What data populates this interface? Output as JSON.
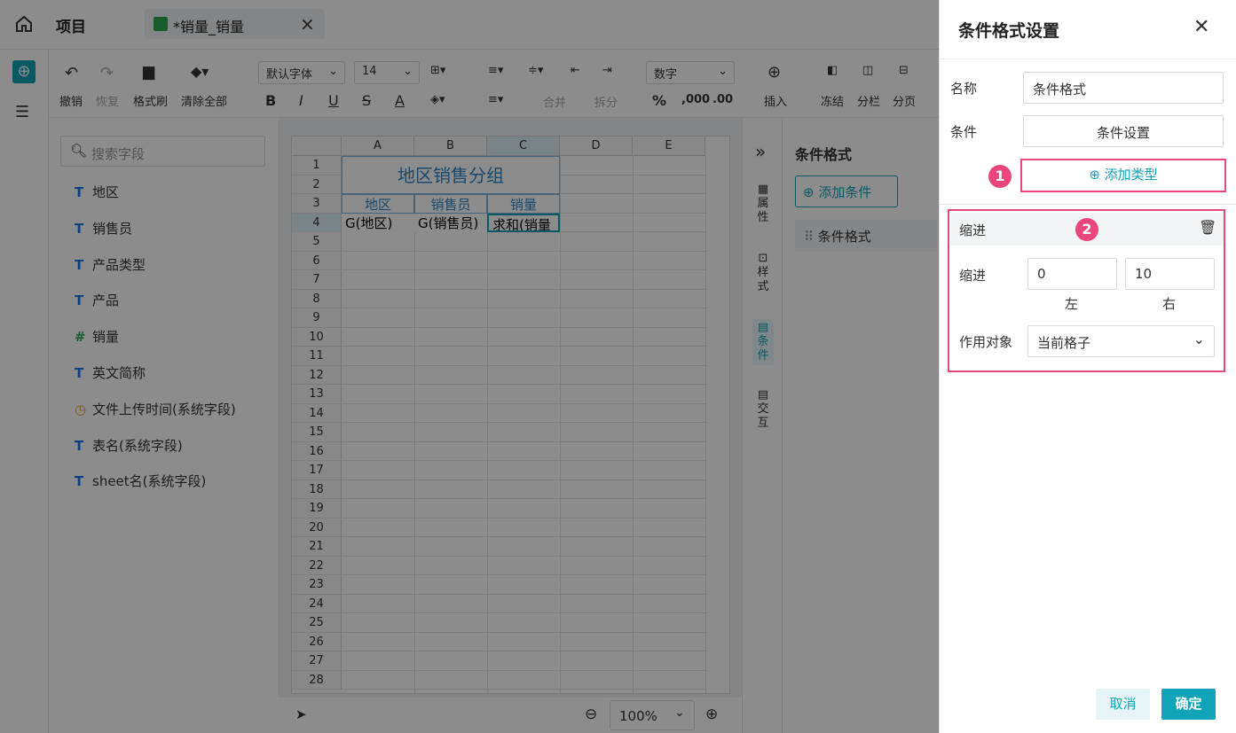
{
  "topbar": {
    "project_label": "项目",
    "tab_title": "*销量_销量",
    "tab_close": "×"
  },
  "ribbon": {
    "undo": "撤销",
    "redo": "恢复",
    "format_painter": "格式刷",
    "clear_all": "清除全部",
    "font_family": "默认字体",
    "font_size": "14",
    "number_format": "数字",
    "merge": "合并",
    "split": "拆分",
    "percent": "%",
    "thousands": ",000",
    "decimals": ".00",
    "insert": "插入",
    "freeze": "冻结",
    "columns": "分栏",
    "page_break": "分页",
    "bold": "B",
    "italic": "I",
    "underline": "U",
    "strike": "S",
    "font_color": "A"
  },
  "fields": {
    "search_placeholder": "搜索字段",
    "items": [
      {
        "icon": "T",
        "label": "地区"
      },
      {
        "icon": "T",
        "label": "销售员"
      },
      {
        "icon": "T",
        "label": "产品类型"
      },
      {
        "icon": "T",
        "label": "产品"
      },
      {
        "icon": "#",
        "label": "销量"
      },
      {
        "icon": "T",
        "label": "英文简称"
      },
      {
        "icon": "clock",
        "label": "文件上传时间(系统字段)"
      },
      {
        "icon": "T",
        "label": "表名(系统字段)"
      },
      {
        "icon": "T",
        "label": "sheet名(系统字段)"
      }
    ]
  },
  "sheet": {
    "columns": [
      "A",
      "B",
      "C",
      "D",
      "E"
    ],
    "rows": [
      "1",
      "2",
      "3",
      "4",
      "5",
      "6",
      "7",
      "8",
      "9",
      "10",
      "11",
      "12",
      "13",
      "14",
      "15",
      "16",
      "17",
      "18",
      "19",
      "20",
      "21",
      "22",
      "23",
      "24",
      "25",
      "26",
      "27",
      "28"
    ],
    "title": "地区销售分组",
    "headers": [
      "地区",
      "销售员",
      "销量"
    ],
    "row4": [
      "G(地区)",
      "G(销售员)",
      "求和(销量"
    ],
    "zoom": "100%"
  },
  "sidetabs": {
    "collapse": "»",
    "props": "属性",
    "style": "样式",
    "condition": "条件",
    "interaction": "交互"
  },
  "condpanel": {
    "title": "条件格式",
    "add_button": "添加条件",
    "item": "条件格式"
  },
  "dialog": {
    "title": "条件格式设置",
    "name_label": "名称",
    "name_value": "条件格式",
    "cond_label": "条件",
    "cond_button": "条件设置",
    "add_type": "添加类型",
    "badge1": "1",
    "badge2": "2",
    "section_title": "缩进",
    "indent_label": "缩进",
    "left_value": "0",
    "right_value": "10",
    "left_caption": "左",
    "right_caption": "右",
    "target_label": "作用对象",
    "target_value": "当前格子",
    "cancel": "取消",
    "confirm": "确定"
  },
  "colors": {
    "accent": "#11a3b8",
    "highlight": "#e8467c",
    "mask": "rgba(0,0,0,0.45)"
  }
}
